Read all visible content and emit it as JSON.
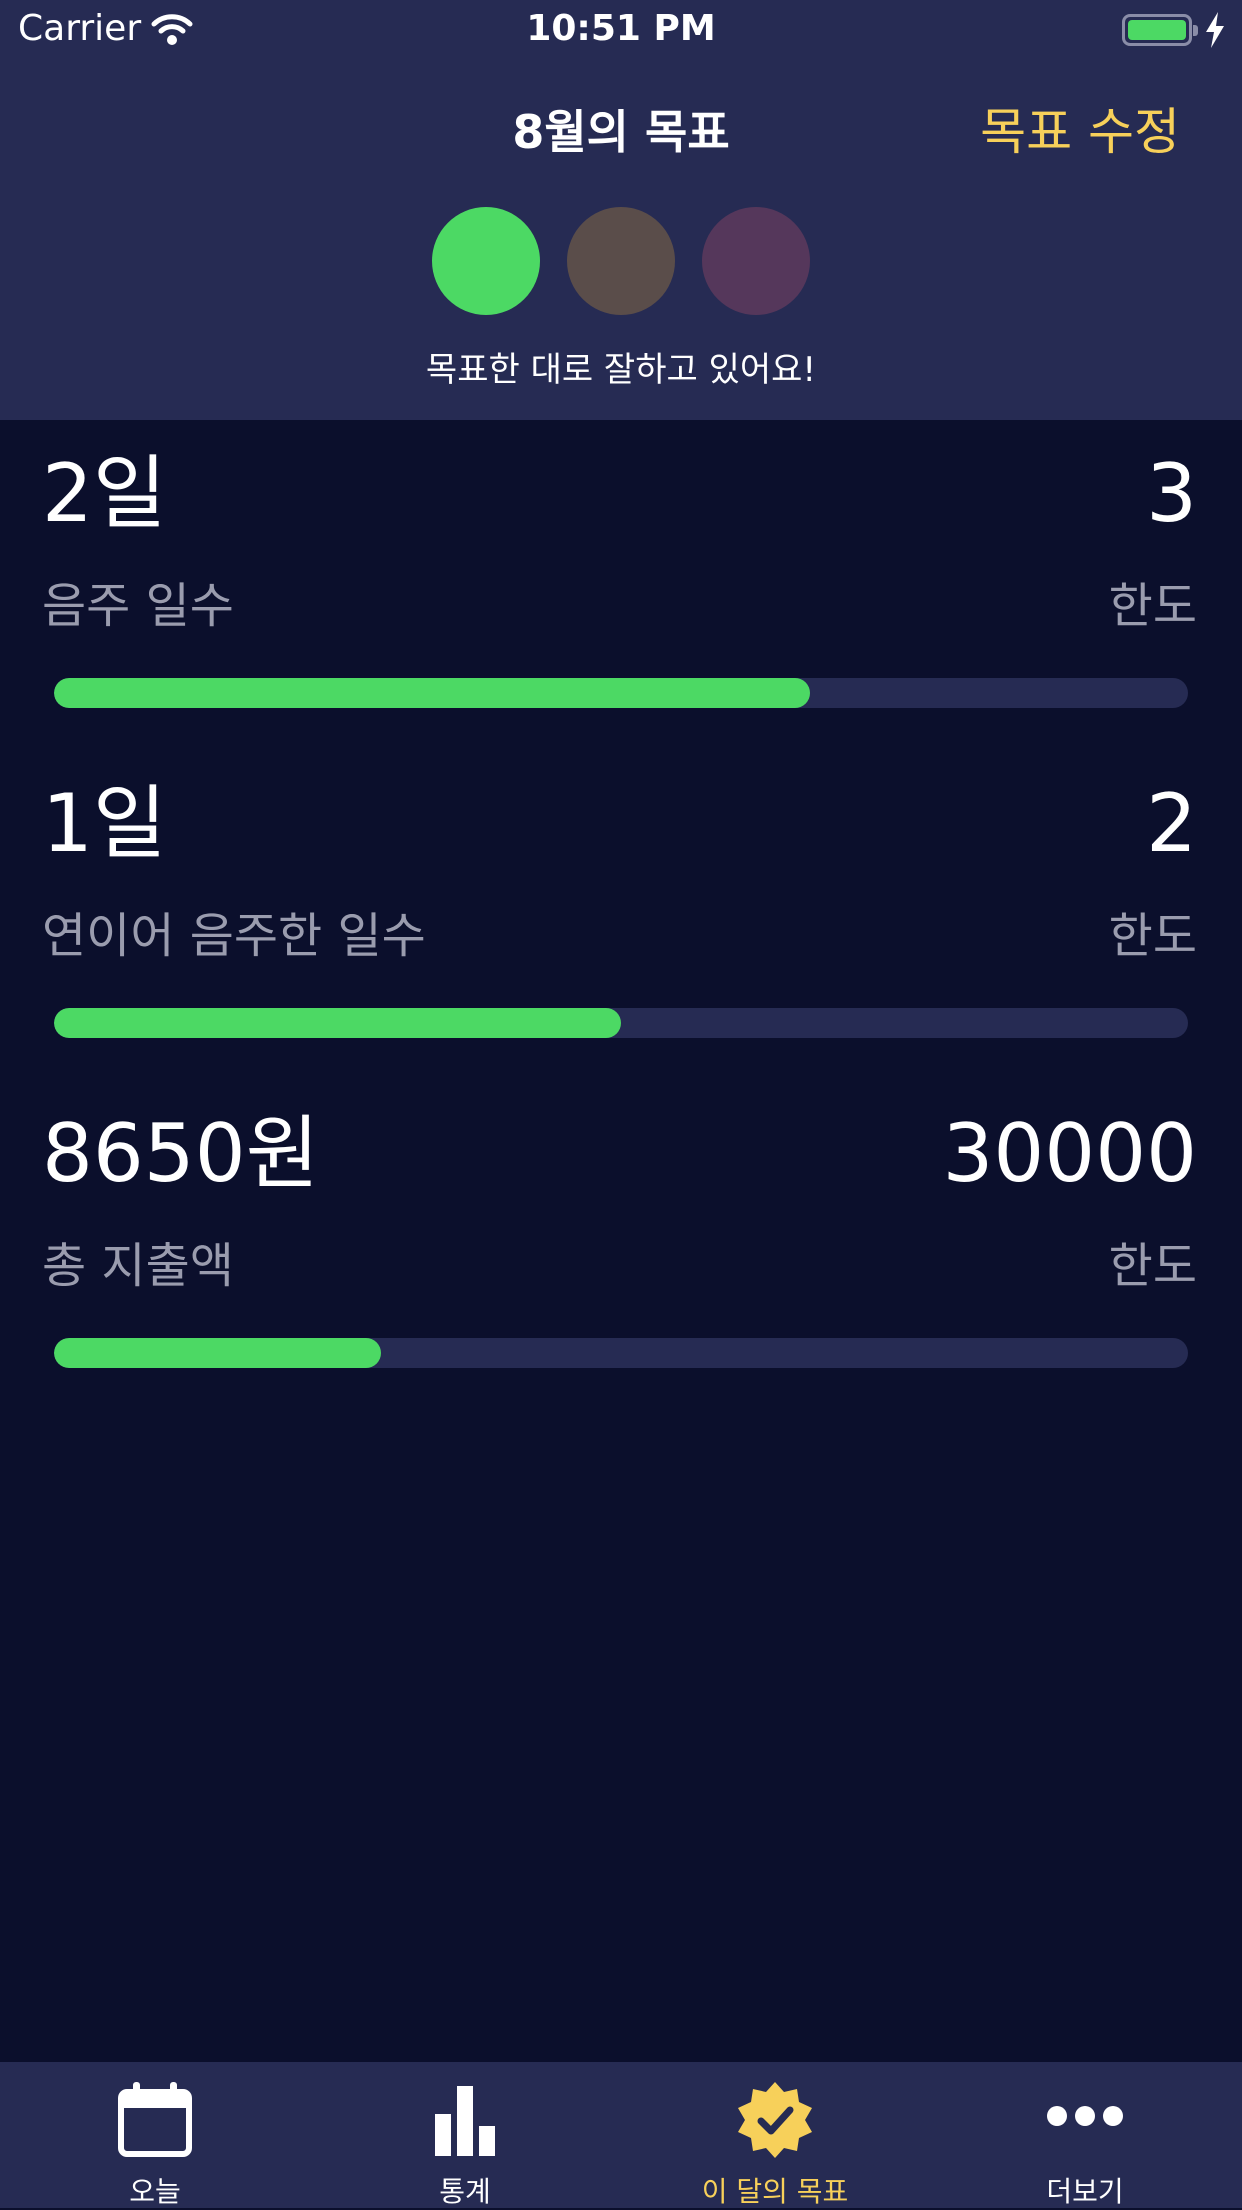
{
  "status": {
    "carrier": "Carrier",
    "time": "10:51 PM"
  },
  "header": {
    "title": "8월의 목표",
    "edit_label": "목표 수정",
    "message": "목표한 대로 잘하고 있어요!",
    "indicator_colors": [
      "#4cd964",
      "#5a4d4a",
      "#55375b"
    ]
  },
  "goals": [
    {
      "value": "2일",
      "label": "음주 일수",
      "limit": "3",
      "limit_label": "한도",
      "progress": 0.667
    },
    {
      "value": "1일",
      "label": "연이어 음주한 일수",
      "limit": "2",
      "limit_label": "한도",
      "progress": 0.5
    },
    {
      "value": "8650원",
      "label": "총 지출액",
      "limit": "30000",
      "limit_label": "한도",
      "progress": 0.2883
    }
  ],
  "tabs": [
    {
      "label": "오늘",
      "icon": "calendar-icon"
    },
    {
      "label": "통계",
      "icon": "bar-chart-icon"
    },
    {
      "label": "이 달의 목표",
      "icon": "check-badge-icon",
      "active": true
    },
    {
      "label": "더보기",
      "icon": "more-icon"
    }
  ],
  "colors": {
    "accent": "#f7d05a",
    "progress": "#4cd964",
    "panel": "#262b53",
    "background": "#0b0f2c"
  }
}
